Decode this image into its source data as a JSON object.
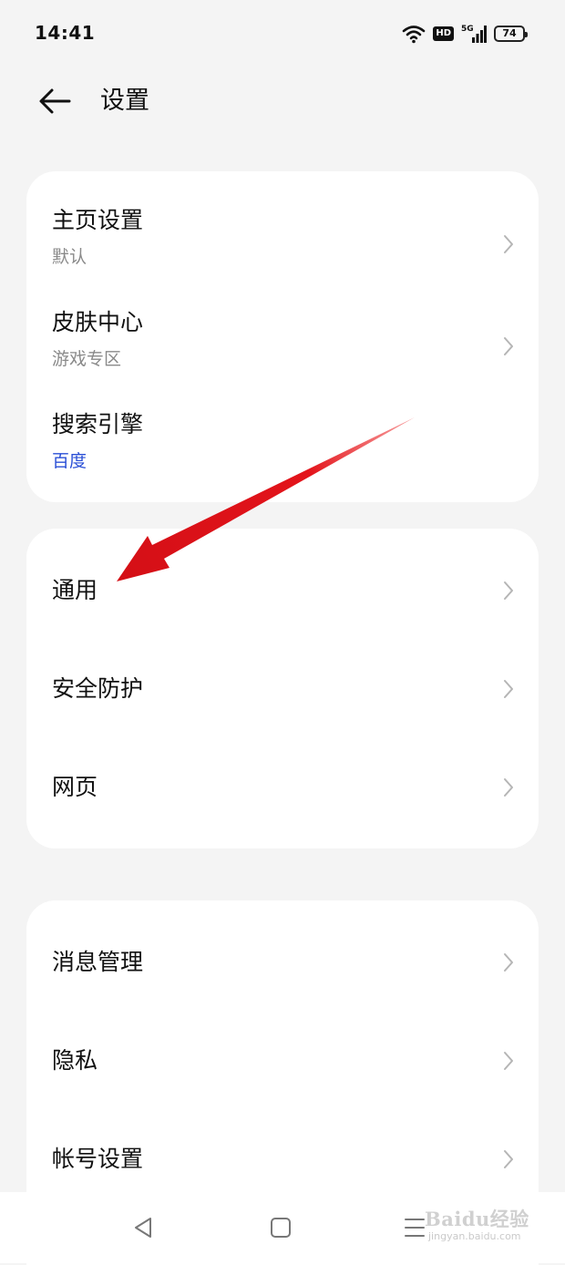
{
  "status_bar": {
    "time": "14:41",
    "network_badge": "HD",
    "network_type": "5G",
    "battery": "74",
    "icons": [
      "wifi-icon",
      "hd-icon",
      "cellular-5g-icon",
      "battery-icon"
    ]
  },
  "header": {
    "back_icon": "arrow-left-icon",
    "title": "设置"
  },
  "cards": [
    {
      "items": [
        {
          "title": "主页设置",
          "subtitle": "默认"
        },
        {
          "title": "皮肤中心",
          "subtitle": "游戏专区"
        },
        {
          "title": "搜索引擎",
          "subtitle": "百度"
        }
      ]
    },
    {
      "items": [
        {
          "title": "通用"
        },
        {
          "title": "安全防护"
        },
        {
          "title": "网页"
        }
      ]
    },
    {
      "items": [
        {
          "title": "消息管理"
        },
        {
          "title": "隐私"
        },
        {
          "title": "帐号设置"
        }
      ]
    }
  ],
  "colors": {
    "background": "#f4f4f4",
    "card": "#ffffff",
    "accent_subtitle": "#2a4fd6",
    "annotation_arrow": "#e3141b"
  },
  "nav_bar": {
    "buttons": [
      "back-triangle-icon",
      "home-square-icon",
      "menu-lines-icon"
    ]
  },
  "watermark": {
    "main": "Baidu经验",
    "sub": "jingyan.baidu.com"
  }
}
